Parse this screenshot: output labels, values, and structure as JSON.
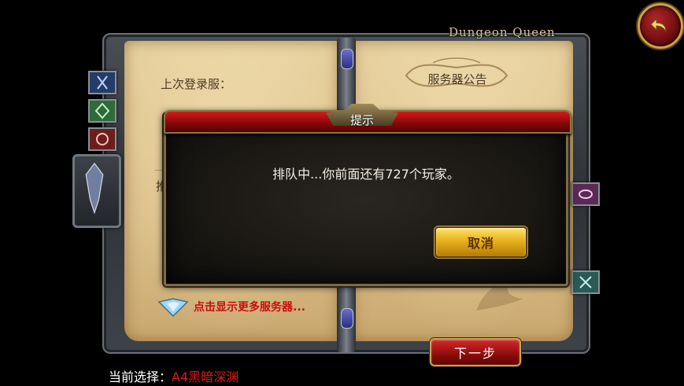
{
  "game": {
    "logo_text": "Dungeon Queen"
  },
  "left_page": {
    "last_login_label": "上次登录服：",
    "partial_label": "推",
    "more_servers_text": "点击显示更多服务器..."
  },
  "right_page": {
    "notice_label": "服务器公告"
  },
  "buttons": {
    "next_label": "下一步",
    "back_icon": "back-arrow-icon"
  },
  "selection": {
    "label": "当前选择：",
    "value": "A4黑暗深渊"
  },
  "dialog": {
    "title": "提示",
    "message": "排队中...你前面还有727个玩家。",
    "cancel_label": "取消"
  },
  "colors": {
    "accent_red": "#c80f0f",
    "gold": "#e7b21c",
    "parchment": "#e9d3a2"
  }
}
